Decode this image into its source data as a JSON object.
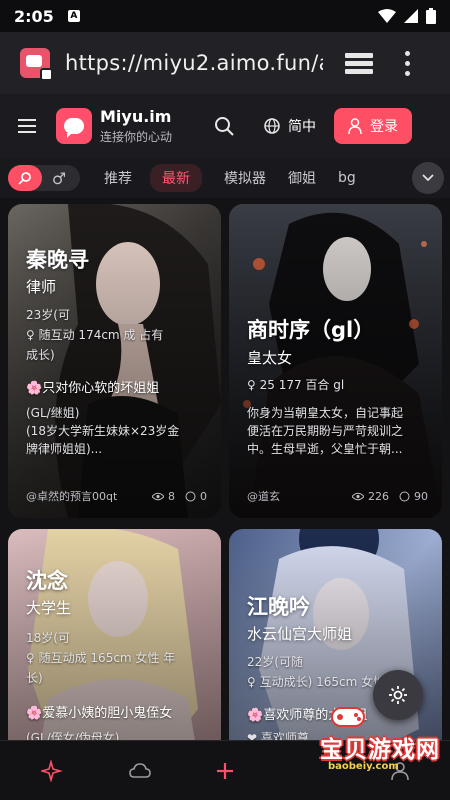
{
  "status_bar": {
    "time": "2:05",
    "badge": "A"
  },
  "browser": {
    "url": "https://miyu2.aimo.fun/a"
  },
  "header": {
    "app_name": "Miyu.im",
    "tagline": "连接你的心动",
    "language": "简中",
    "login_label": "登录"
  },
  "filter": {
    "tabs": [
      {
        "label": "推荐",
        "active": false
      },
      {
        "label": "最新",
        "active": true
      },
      {
        "label": "模拟器",
        "active": false
      },
      {
        "label": "御姐",
        "active": false
      },
      {
        "label": "bg",
        "active": false
      }
    ]
  },
  "cards": [
    {
      "name": "秦晚寻",
      "role": "律师",
      "lines": [
        "23岁(可",
        "♀ 随互动    174cm  成  占有",
        "成长)"
      ],
      "highlight": "只对你心软的坏姐姐",
      "desc": [
        "(GL/继姐)",
        "(18岁大学新生妹妹×23岁金",
        "牌律师姐姐)..."
      ],
      "author": "@卓然的预言00qt",
      "views": "8",
      "comments": "0"
    },
    {
      "name": "商时序（gl）",
      "role": "皇太女",
      "lines": [
        "♀ 25  177  百合  gl"
      ],
      "highlight": "",
      "desc": [
        "你身为当朝皇太女，自记事起",
        "便活在万民期盼与严苛规训之",
        "中。生母早逝，父皇忙于朝..."
      ],
      "author": "@道玄",
      "views": "226",
      "comments": "90"
    },
    {
      "name": "沈念",
      "role": "大学生",
      "lines": [
        "18岁(可",
        "♀ 随互动成   165cm  女性  年",
        "长)"
      ],
      "highlight": "爱慕小姨的胆小鬼侄女",
      "desc": [
        "(GL/侄女/伪母女)"
      ],
      "author": "",
      "views": "",
      "comments": ""
    },
    {
      "name": "江晚吟",
      "role": "水云仙宫大师姐",
      "lines": [
        "22岁(可随",
        "♀ 互动成长)    165cm  女性"
      ],
      "highlight": "喜欢师尊的大师姐",
      "desc": [
        "❤ 喜欢师尊..."
      ],
      "author": "",
      "views": "",
      "comments": ""
    }
  ],
  "watermark": {
    "title": "宝贝游戏网",
    "url": "baobeiy.com"
  }
}
